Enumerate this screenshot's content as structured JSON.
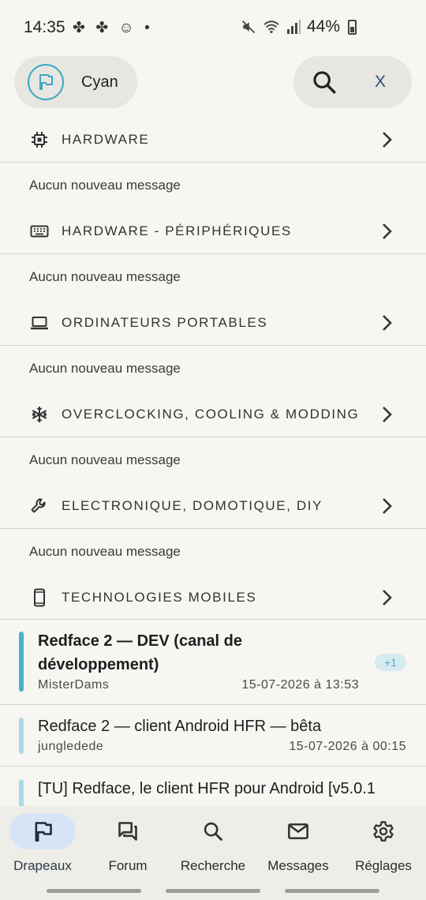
{
  "status_bar": {
    "time": "14:35",
    "left_icons": "✤ ✤ ☺ •",
    "battery": "44%"
  },
  "top_bar": {
    "filter_label": "Cyan",
    "close_label": "X"
  },
  "categories": [
    {
      "icon": "cpu-icon",
      "title": "HARDWARE",
      "status": "Aucun nouveau message"
    },
    {
      "icon": "keyboard-icon",
      "title": "HARDWARE - PÉRIPHÉRIQUES",
      "status": "Aucun nouveau message"
    },
    {
      "icon": "laptop-icon",
      "title": "ORDINATEURS PORTABLES",
      "status": "Aucun nouveau message"
    },
    {
      "icon": "snowflake-icon",
      "title": "OVERCLOCKING, COOLING & MODDING",
      "status": "Aucun nouveau message"
    },
    {
      "icon": "wrench-icon",
      "title": "ELECTRONIQUE, DOMOTIQUE, DIY",
      "status": "Aucun nouveau message"
    },
    {
      "icon": "smartphone-icon",
      "title": "TECHNOLOGIES MOBILES"
    }
  ],
  "topics": [
    {
      "title_line1": "Redface 2 — DEV (canal de",
      "title_line2": "développement)",
      "author": "MisterDams",
      "date": "15-07-2026 à 13:53",
      "badge": "+1",
      "bar_color": "#4bb0c8",
      "bold": true
    },
    {
      "title_line1": "Redface 2 — client Android HFR — bêta",
      "author": "jungledede",
      "date": "15-07-2026 à 00:15",
      "bar_color": "#a9dbe7",
      "bold": false
    },
    {
      "title_line1": "[TU] Redface, le client HFR pour Android [v5.0.1",
      "bar_color": "#a9dbe7",
      "bold": false
    }
  ],
  "bottom_nav": [
    {
      "label": "Drapeaux",
      "icon": "flag-icon",
      "active": true
    },
    {
      "label": "Forum",
      "icon": "forum-icon",
      "active": false
    },
    {
      "label": "Recherche",
      "icon": "search-icon",
      "active": false
    },
    {
      "label": "Messages",
      "icon": "mail-icon",
      "active": false
    },
    {
      "label": "Réglages",
      "icon": "gear-icon",
      "active": false
    }
  ],
  "colors": {
    "accent_cyan": "#4bb0c8",
    "active_nav": "#d5e5f6",
    "background": "#f8f6f2"
  }
}
